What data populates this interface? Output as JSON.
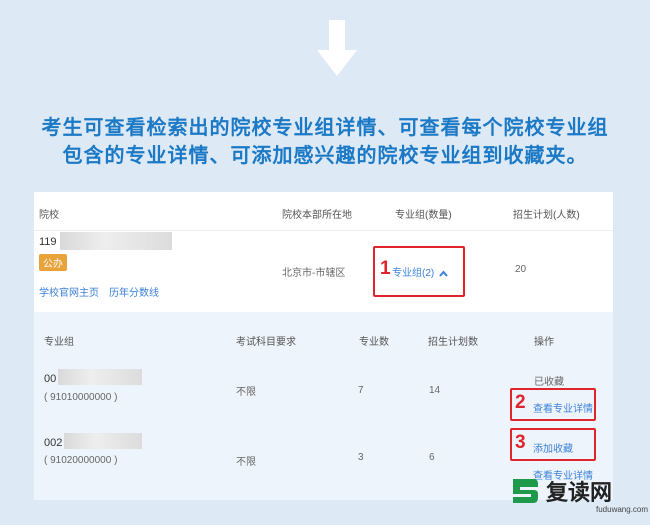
{
  "headline": {
    "line1": "考生可查看检索出的院校专业组详情、可查看每个院校专业组",
    "line2": "包含的专业详情、可添加感兴趣的院校专业组到收藏夹。"
  },
  "school_table": {
    "headers": {
      "school": "院校",
      "location": "院校本部所在地",
      "groups": "专业组(数量)",
      "plan": "招生计划(人数)"
    },
    "row": {
      "code": "119",
      "type_tag": "公办",
      "homepage_link": "学校官网主页",
      "scores_link": "历年分数线",
      "location": "北京市-市辖区",
      "groups_toggle": "专业组(2)",
      "plan": "20"
    }
  },
  "group_table": {
    "headers": {
      "group": "专业组",
      "subjects": "考试科目要求",
      "majors": "专业数",
      "plan": "招生计划数",
      "ops": "操作"
    },
    "rows": [
      {
        "code": "00",
        "id": "( 91010000000 )",
        "subjects": "不限",
        "majors": "7",
        "plan": "14",
        "status": "已收藏",
        "detail_link": "查看专业详情"
      },
      {
        "code": "002",
        "id": "( 91020000000 )",
        "subjects": "不限",
        "majors": "3",
        "plan": "6",
        "add_link": "添加收藏",
        "detail_link": "查看专业详情"
      }
    ]
  },
  "annotations": {
    "n1": "1",
    "n2": "2",
    "n3": "3"
  },
  "watermark": {
    "name": "复读网",
    "url": "fuduwang.com"
  },
  "colors": {
    "headline": "#1c79c6",
    "link": "#3b82d8",
    "annotation_red": "#e0242c",
    "tag": "#e8a33a"
  }
}
